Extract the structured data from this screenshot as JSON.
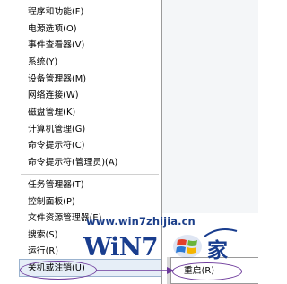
{
  "menu": {
    "items": [
      {
        "label": "程序和功能(F)"
      },
      {
        "label": "电源选项(O)"
      },
      {
        "label": "事件查看器(V)"
      },
      {
        "label": "系统(Y)"
      },
      {
        "label": "设备管理器(M)"
      },
      {
        "label": "网络连接(W)"
      },
      {
        "label": "磁盘管理(K)"
      },
      {
        "label": "计算机管理(G)"
      },
      {
        "label": "命令提示符(C)"
      },
      {
        "label": "命令提示符(管理员)(A)"
      },
      {
        "label": "任务管理器(T)"
      },
      {
        "label": "控制面板(P)"
      },
      {
        "label": "文件资源管理器(E)"
      },
      {
        "label": "搜索(S)"
      },
      {
        "label": "运行(R)"
      },
      {
        "label": "关机或注销(U)"
      }
    ]
  },
  "submenu": {
    "items": [
      {
        "label": "重启(R)"
      }
    ]
  },
  "watermark": {
    "url": "www.win7zhijia.cn",
    "logo_text": "WiN7",
    "logo_char": "家"
  },
  "colors": {
    "annotation": "#6d3a9b",
    "watermark": "#1c3f8a",
    "highlight": "#e6eef7"
  }
}
